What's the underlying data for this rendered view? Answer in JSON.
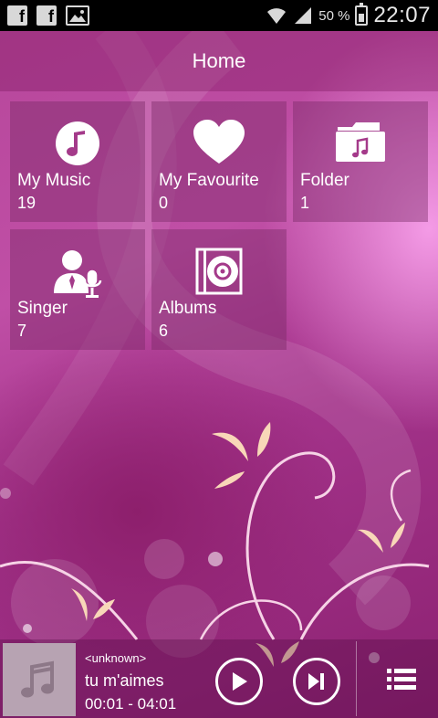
{
  "status_bar": {
    "notification_icons": [
      "facebook-icon",
      "facebook-icon",
      "image-icon"
    ],
    "battery_percent": "50 %",
    "time": "22:07",
    "icons": [
      "wifi-icon",
      "signal-icon",
      "battery-icon"
    ]
  },
  "header": {
    "title": "Home"
  },
  "tiles": [
    {
      "label": "My Music",
      "count": "19",
      "icon": "music-note-icon"
    },
    {
      "label": "My Favourite",
      "count": "0",
      "icon": "heart-icon"
    },
    {
      "label": "Folder",
      "count": "1",
      "icon": "music-folder-icon"
    },
    {
      "label": "Singer",
      "count": "7",
      "icon": "singer-icon"
    },
    {
      "label": "Albums",
      "count": "6",
      "icon": "album-disc-icon"
    }
  ],
  "player": {
    "artist": "<unknown>",
    "title": "tu m'aimes",
    "time": "00:01 - 04:01",
    "icons": [
      "music-note-icon",
      "play-icon",
      "next-icon",
      "playlist-icon"
    ]
  },
  "colors": {
    "accent": "#b6469a",
    "tile_bg": "#78286a"
  }
}
